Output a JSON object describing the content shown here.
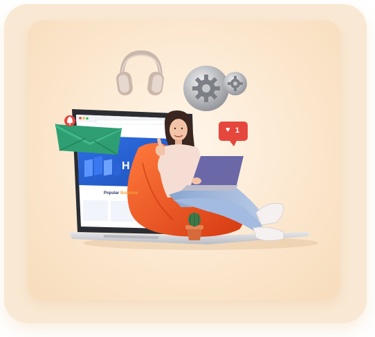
{
  "scene": {
    "accent_colors": {
      "card_background": "#f9e9d4",
      "beanbag": "#f0521f",
      "laptop_screen": "#2a63d8",
      "envelope": "#2f9e73",
      "notification_badge": "#e5473c"
    },
    "icons": [
      "headphones-icon",
      "gears-icon",
      "envelope-icon",
      "notification-bell-icon",
      "heart-notification-icon",
      "cactus-icon"
    ]
  },
  "browser": {
    "url": "",
    "hero_letter": "H",
    "section_label_start": "Popular",
    "section_label_end": "Bookmar"
  },
  "notification": {
    "like_count": "1"
  }
}
